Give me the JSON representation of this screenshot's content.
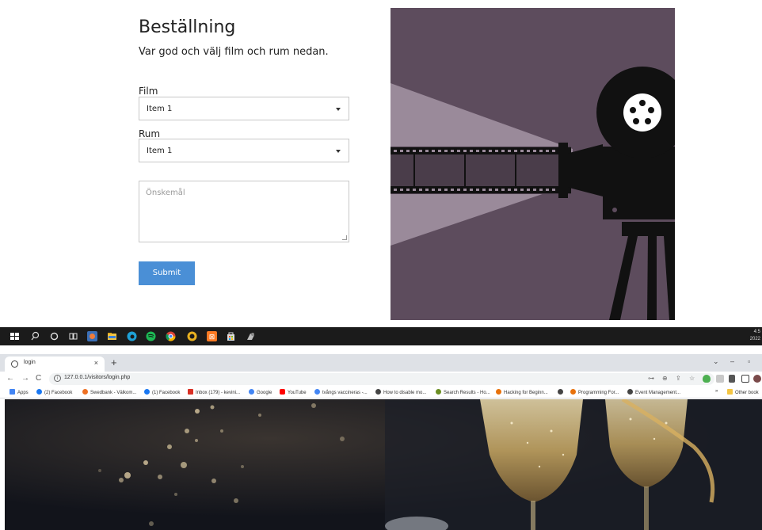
{
  "form": {
    "title": "Beställning",
    "subtitle": "Var god och välj film och rum nedan.",
    "film_label": "Film",
    "film_selected": "Item 1",
    "room_label": "Rum",
    "room_selected": "Item 1",
    "wishes_placeholder": "Önskemål",
    "submit_label": "Submit",
    "submit_color": "#4a8fd6",
    "art_bg_color": "#5d4c5d"
  },
  "taskbar": {
    "time": "4:5",
    "date": "2022"
  },
  "browser": {
    "tab_title": "login",
    "tab_close": "×",
    "new_tab": "+",
    "url": "127.0.0.1/visitors/login.php",
    "nav_back": "←",
    "nav_forward": "→",
    "nav_reload": "C",
    "win_min": "–",
    "win_max": "▫",
    "win_chevron": "⌄"
  },
  "bookmarks": [
    {
      "label": "Apps",
      "color": "#4285f4"
    },
    {
      "label": "(2) Facebook",
      "color": "#1877f2"
    },
    {
      "label": "Swedbank - Välkom...",
      "color": "#ee7023"
    },
    {
      "label": "(1) Facebook",
      "color": "#1877f2"
    },
    {
      "label": "Inbox (179) - kevini...",
      "color": "#d93025"
    },
    {
      "label": "Google",
      "color": "#4285f4"
    },
    {
      "label": "YouTube",
      "color": "#ff0000"
    },
    {
      "label": "tvångs vaccineras -...",
      "color": "#4285f4"
    },
    {
      "label": "How to disable mo...",
      "color": "#444444"
    },
    {
      "label": "Search Results - Ho...",
      "color": "#6b8e23"
    },
    {
      "label": "Hacking for Beginn...",
      "color": "#e8710a"
    },
    {
      "label": "",
      "color": "#444444"
    },
    {
      "label": "Programming For...",
      "color": "#e8710a"
    },
    {
      "label": "Event Management...",
      "color": "#444444"
    }
  ],
  "bookmarks_more": "»",
  "bookmarks_other": "Other book"
}
